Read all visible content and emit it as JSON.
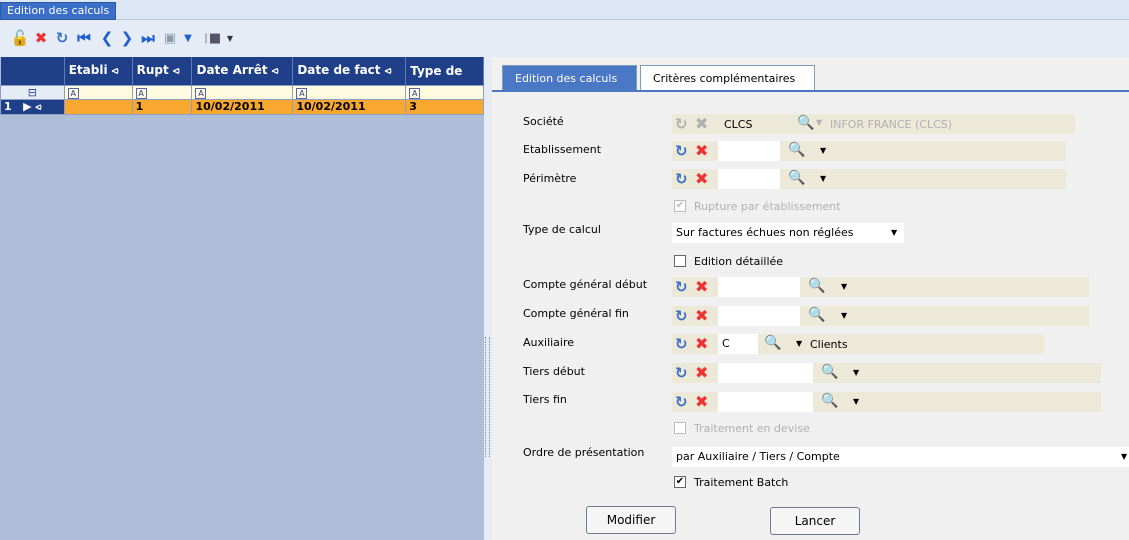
{
  "window": {
    "tab_title": "Edition des calculs"
  },
  "toolbar": {
    "icons": [
      "unlock-icon",
      "delete-icon",
      "refresh-icon",
      "first-icon",
      "previous-icon",
      "next-icon",
      "last-icon",
      "view-icon",
      "dropdown-icon",
      "export-icon",
      "dropdown-icon"
    ]
  },
  "grid": {
    "columns": [
      "Etabli",
      "Rupt",
      "Date Arrêt",
      "Date de fact",
      "Type de"
    ],
    "filter_symbol": "A",
    "row": {
      "index": "1",
      "etabli": "",
      "rupt": "1",
      "date_arret": "10/02/2011",
      "date_fact": "10/02/2011",
      "type": "3"
    }
  },
  "tabs": {
    "active": "Edition des calculs",
    "inactive": "Critères complémentaires"
  },
  "form": {
    "societe": {
      "label": "Société",
      "code": "CLCS",
      "name": "INFOR FRANCE (CLCS)"
    },
    "etablissement": {
      "label": "Etablissement"
    },
    "perimetre": {
      "label": "Périmètre"
    },
    "rupture": {
      "label": "Rupture par établissement",
      "checked": true
    },
    "type_calcul": {
      "label": "Type de calcul",
      "value": "Sur factures échues non réglées"
    },
    "edition_detaillee": {
      "label": "Edition détaillée",
      "checked": false
    },
    "compte_debut": {
      "label": "Compte général début"
    },
    "compte_fin": {
      "label": "Compte général fin"
    },
    "auxiliaire": {
      "label": "Auxiliaire",
      "code": "C",
      "name": "Clients"
    },
    "tiers_debut": {
      "label": "Tiers début"
    },
    "tiers_fin": {
      "label": "Tiers fin"
    },
    "traitement_devise": {
      "label": "Traitement en devise",
      "checked": false
    },
    "ordre": {
      "label": "Ordre de présentation",
      "value": "par Auxiliaire / Tiers / Compte"
    },
    "traitement_batch": {
      "label": "Traitement Batch",
      "checked": true
    }
  },
  "buttons": {
    "modifier": "Modifier",
    "lancer": "Lancer"
  },
  "colors": {
    "accent": "#4b78c4",
    "header": "#1f3f88",
    "selected_row": "#f8a82f"
  }
}
